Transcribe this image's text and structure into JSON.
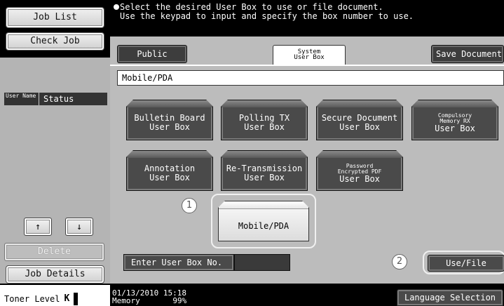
{
  "sidebar": {
    "job_list": "Job List",
    "check_job": "Check Job",
    "col_user_name": "User Name",
    "col_status": "Status",
    "arrow_up": "↑",
    "arrow_down": "↓",
    "delete": "Delete",
    "job_details": "Job Details",
    "toner_label": "Toner Level",
    "toner_color": "K"
  },
  "message": {
    "line1": "Select the desired User Box to use or file document.",
    "line2": "Use the keypad to input and specify the box number to use."
  },
  "tabs": {
    "public": "Public",
    "system_line1": "System",
    "system_line2": "User Box",
    "save_document": "Save Document"
  },
  "section_title": "Mobile/PDA",
  "boxes": [
    {
      "line1": "Bulletin Board",
      "line2": "User Box"
    },
    {
      "line1": "Polling TX",
      "line2": "User Box"
    },
    {
      "line1": "Secure Document",
      "line2": "User Box"
    },
    {
      "small1": "Compulsory",
      "small2": "Memory RX",
      "line2": "User Box"
    },
    {
      "line1": "Annotation",
      "line2": "User Box"
    },
    {
      "line1": "Re-Transmission",
      "line2": "User Box"
    },
    {
      "small1": "Password",
      "small2": "Encrypted PDF",
      "line2": "User Box"
    }
  ],
  "mobile_pda_button": "Mobile/PDA",
  "callouts": {
    "one": "1",
    "two": "2"
  },
  "enter_box_no": "Enter User Box No.",
  "use_file": "Use/File",
  "footer": {
    "datetime": "01/13/2010   15:18",
    "memory_label": "Memory",
    "memory_value": "99%",
    "language_selection": "Language Selection"
  }
}
